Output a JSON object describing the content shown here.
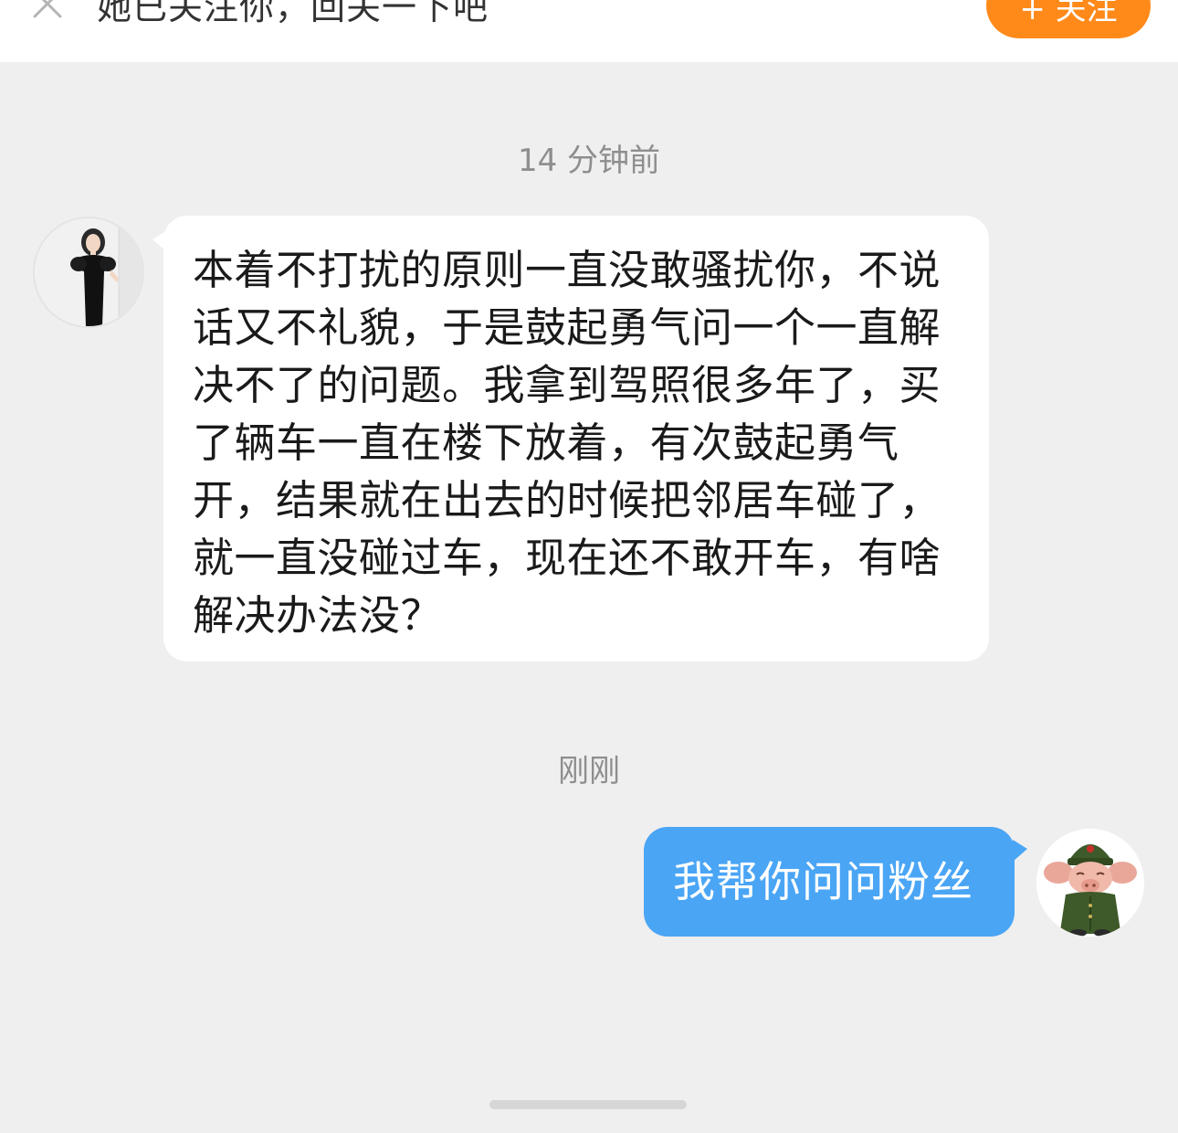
{
  "banner": {
    "text": "她已关注你，回关一下吧",
    "follow_label": "+ 关注"
  },
  "chat": {
    "messages": [
      {
        "timestamp": "14 分钟前",
        "direction": "incoming",
        "text": "本着不打扰的原则一直没敢骚扰你，不说话又不礼貌，于是鼓起勇气问一个一直解决不了的问题。我拿到驾照很多年了，买了辆车一直在楼下放着，有次鼓起勇气开，结果就在出去的时候把邻居车碰了，就一直没碰过车，现在还不敢开车，有啥解决办法没？"
      },
      {
        "timestamp": "刚刚",
        "direction": "outgoing",
        "text": "我帮你问问粉丝"
      }
    ]
  },
  "colors": {
    "follow_button": "#ff8a1a",
    "outgoing_bubble": "#4aa5f5",
    "incoming_bubble": "#ffffff",
    "background": "#efefef",
    "timestamp_text": "#8e8e8e"
  },
  "icons": {
    "close": "close-icon"
  }
}
